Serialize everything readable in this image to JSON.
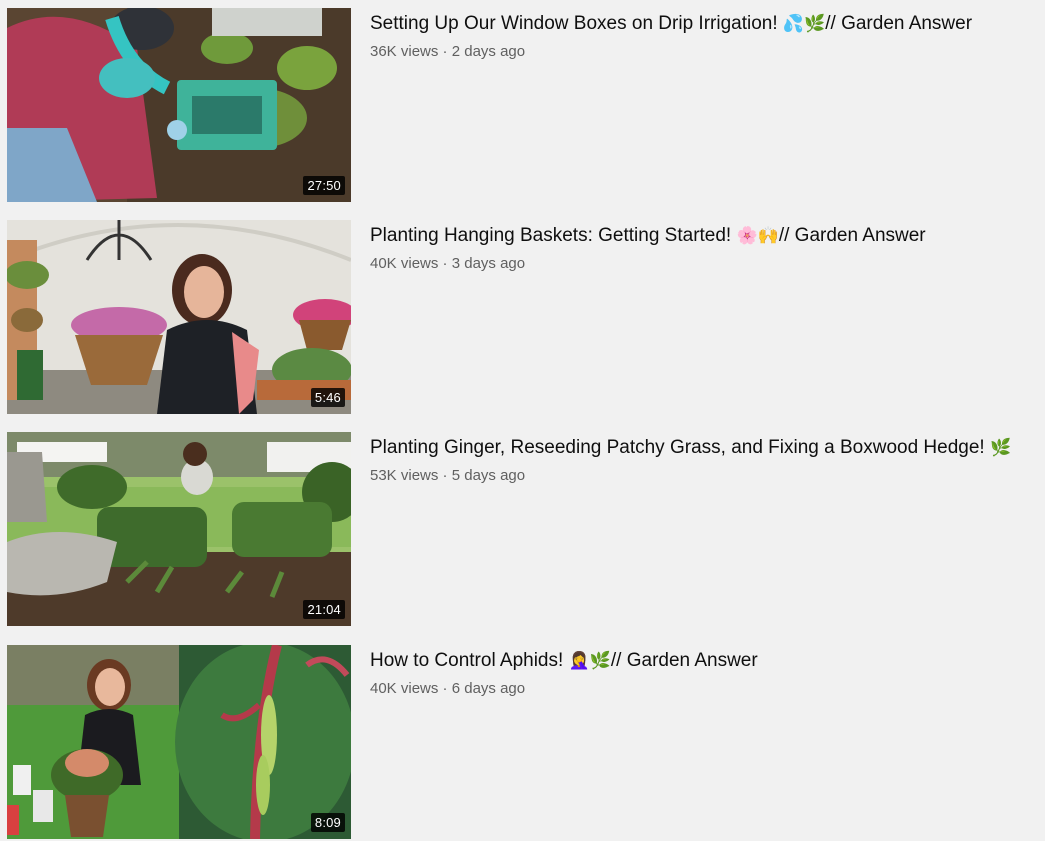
{
  "feed": {
    "videos": [
      {
        "title": "Setting Up Our Window Boxes on Drip Irrigation!",
        "emoji": "💦🌿",
        "channel_suffix": "// Garden Answer",
        "views": "36K views",
        "age": "2 days ago",
        "separator": " · ",
        "duration": "27:50"
      },
      {
        "title": "Planting Hanging Baskets: Getting Started!",
        "emoji": "🌸🙌",
        "channel_suffix": "// Garden Answer",
        "views": "40K views",
        "age": "3 days ago",
        "separator": " · ",
        "duration": "5:46"
      },
      {
        "title": "Planting Ginger, Reseeding Patchy Grass, and Fixing a Boxwood Hedge!",
        "emoji": "🌿",
        "channel_suffix": "",
        "views": "53K views",
        "age": "5 days ago",
        "separator": " · ",
        "duration": "21:04"
      },
      {
        "title": "How to Control Aphids!",
        "emoji": "🤦‍♀️🌿",
        "channel_suffix": "// Garden Answer",
        "views": "40K views",
        "age": "6 days ago",
        "separator": " · ",
        "duration": "8:09"
      }
    ]
  },
  "colors": {
    "background": "#f1f1f1",
    "title_text": "#0f0f0f",
    "meta_text": "#606060",
    "duration_bg": "#000000"
  }
}
